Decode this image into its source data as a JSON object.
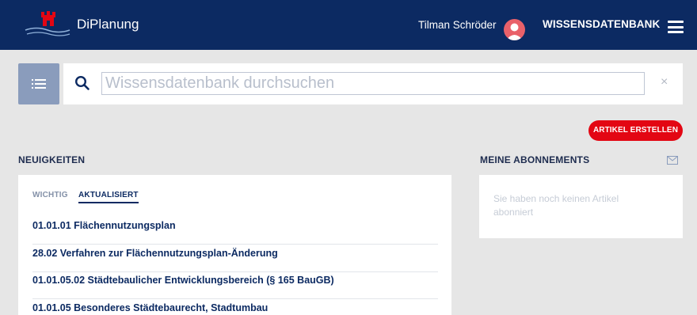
{
  "header": {
    "brand": "DiPlanung",
    "user_name": "Tilman Schröder",
    "section_title": "WISSENSDATENBANK",
    "menu_icon": "hamburger-menu-icon",
    "colors": {
      "bar": "#0c2a62",
      "logo_red": "#e30613",
      "avatar": "#e9616a"
    }
  },
  "search": {
    "placeholder": "Wissensdatenbank durchsuchen",
    "value": "",
    "clear_label": "×"
  },
  "actions": {
    "create_article": "ARTIKEL ERSTELLEN",
    "accent": "#e30613"
  },
  "news": {
    "heading": "NEUIGKEITEN",
    "tabs": [
      {
        "label": "WICHTIG",
        "active": false
      },
      {
        "label": "AKTUALISIERT",
        "active": true
      }
    ],
    "items": [
      "01.01.01 Flächennutzungsplan",
      "28.02 Verfahren zur Flächennutzungsplan-Änderung",
      "01.01.05.02 Städtebaulicher Entwicklungsbereich (§ 165 BauGB)",
      "01.01.05 Besonderes Städtebaurecht, Stadtumbau"
    ]
  },
  "subscriptions": {
    "heading": "MEINE ABONNEMENTS",
    "empty_text": "Sie haben noch keinen Artikel abonniert"
  }
}
